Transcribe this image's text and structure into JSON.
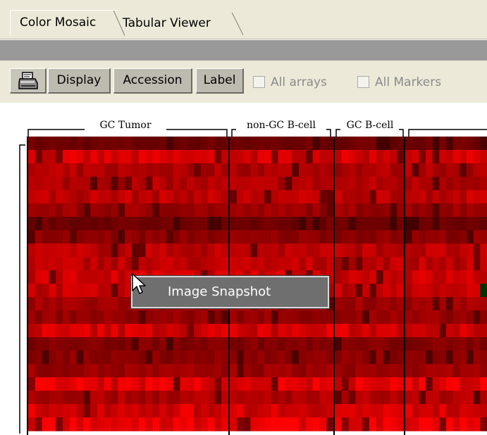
{
  "tabs": [
    {
      "label": "Color Mosaic",
      "active": true
    },
    {
      "label": "Tabular Viewer",
      "active": false
    }
  ],
  "toolbar": {
    "print_icon": "printer-icon",
    "display_label": "Display",
    "accession_label": "Accession",
    "label_label": "Label",
    "all_arrays_label": "All arrays",
    "all_markers_label": "All Markers",
    "all_arrays_checked": false,
    "all_markers_checked": false
  },
  "mosaic": {
    "groups": [
      {
        "label": "GC Tumor"
      },
      {
        "label": "non-GC B-cell"
      },
      {
        "label": "GC B-cell"
      }
    ],
    "colors": {
      "high": "#ff0000",
      "low": "#1a0000",
      "green": "#004400"
    }
  },
  "context_menu": {
    "items": [
      {
        "label": "Image Snapshot"
      }
    ]
  }
}
